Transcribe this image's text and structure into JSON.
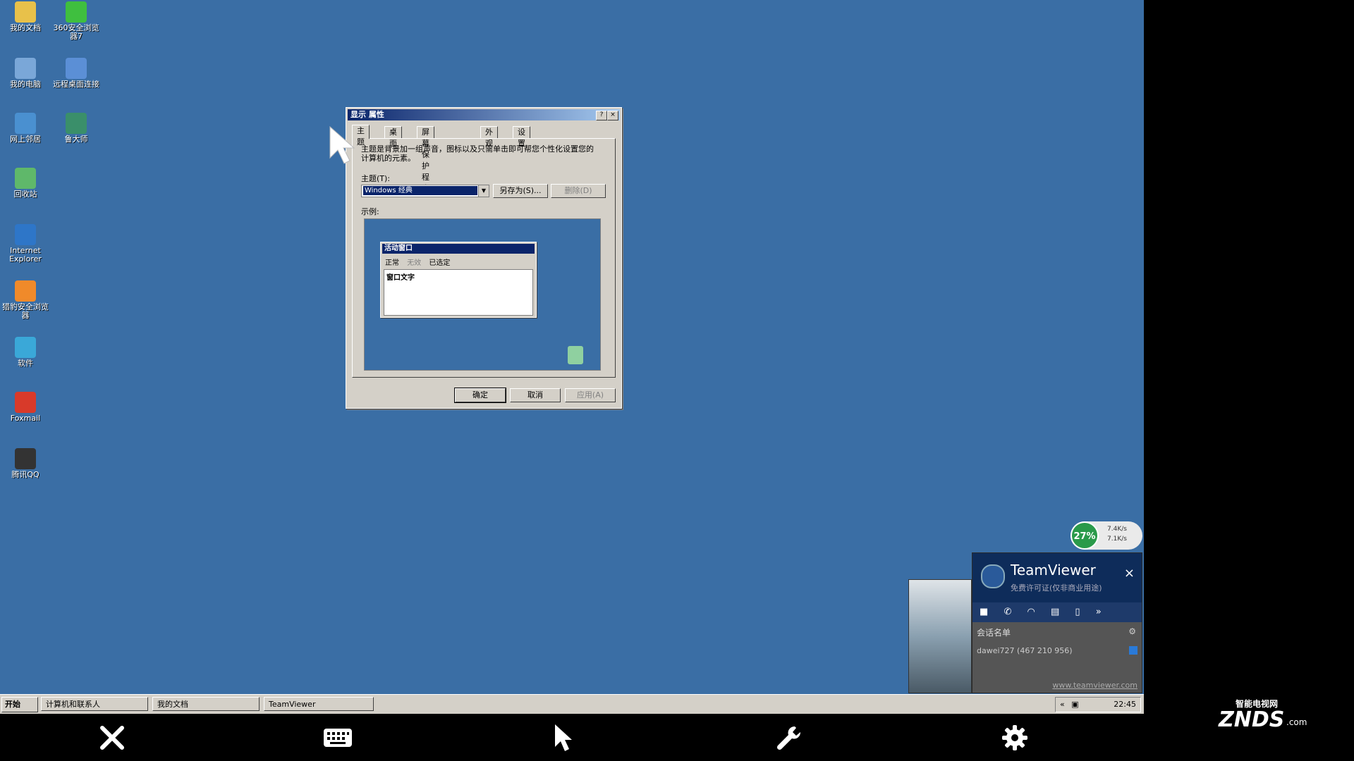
{
  "desktop_icons": [
    {
      "label": "我的文档",
      "color": "#e8c14a"
    },
    {
      "label": "360安全浏览器7",
      "color": "#3fbf3f"
    },
    {
      "label": "我的电脑",
      "color": "#7aa7d8"
    },
    {
      "label": "远程桌面连接",
      "color": "#5b8fd6"
    },
    {
      "label": "网上邻居",
      "color": "#4a90d0"
    },
    {
      "label": "鲁大师",
      "color": "#3a8f6a"
    },
    {
      "label": "回收站",
      "color": "#5fb86a"
    },
    {
      "label": "Internet Explorer",
      "color": "#2e76c8"
    },
    {
      "label": "猎豹安全浏览器",
      "color": "#f08a2a"
    },
    {
      "label": "软件",
      "color": "#3aa8d8"
    },
    {
      "label": "Foxmail",
      "color": "#d83a2a"
    },
    {
      "label": "腾讯QQ",
      "color": "#333333"
    }
  ],
  "dialog": {
    "title": "显示 属性",
    "help_btn": "?",
    "close_btn": "×",
    "tabs": [
      "主题",
      "桌面",
      "屏幕保护程序",
      "外观",
      "设置"
    ],
    "description": "主题是背景加一组声音，图标以及只需单击即可帮您个性化设置您的计算机的元素。",
    "theme_label": "主题(T):",
    "theme_value": "Windows 经典",
    "save_as": "另存为(S)...",
    "delete": "删除(D)",
    "sample_label": "示例:",
    "preview": {
      "title": "活动窗口",
      "menu": [
        "正常",
        "无效",
        "已选定"
      ],
      "body_text": "窗口文字"
    },
    "ok": "确定",
    "cancel": "取消",
    "apply": "应用(A)"
  },
  "taskbar": {
    "start": "开始",
    "tasks": [
      "计算机和联系人",
      "我的文档",
      "TeamViewer"
    ],
    "clock": "22:45"
  },
  "teamviewer": {
    "name": "TeamViewer",
    "subtitle": "免费许可证(仅非商业用途)",
    "close": "×",
    "list_header": "会话名单",
    "contact": "dawei727 (467 210 956)",
    "url": "www.teamviewer.com"
  },
  "speed_widget": {
    "percent": "27%",
    "up": "7.4K/s",
    "down": "7.1K/s"
  },
  "watermark": {
    "text": "ZNDS",
    "cn": "智能电视网",
    "suffix": ".com"
  }
}
